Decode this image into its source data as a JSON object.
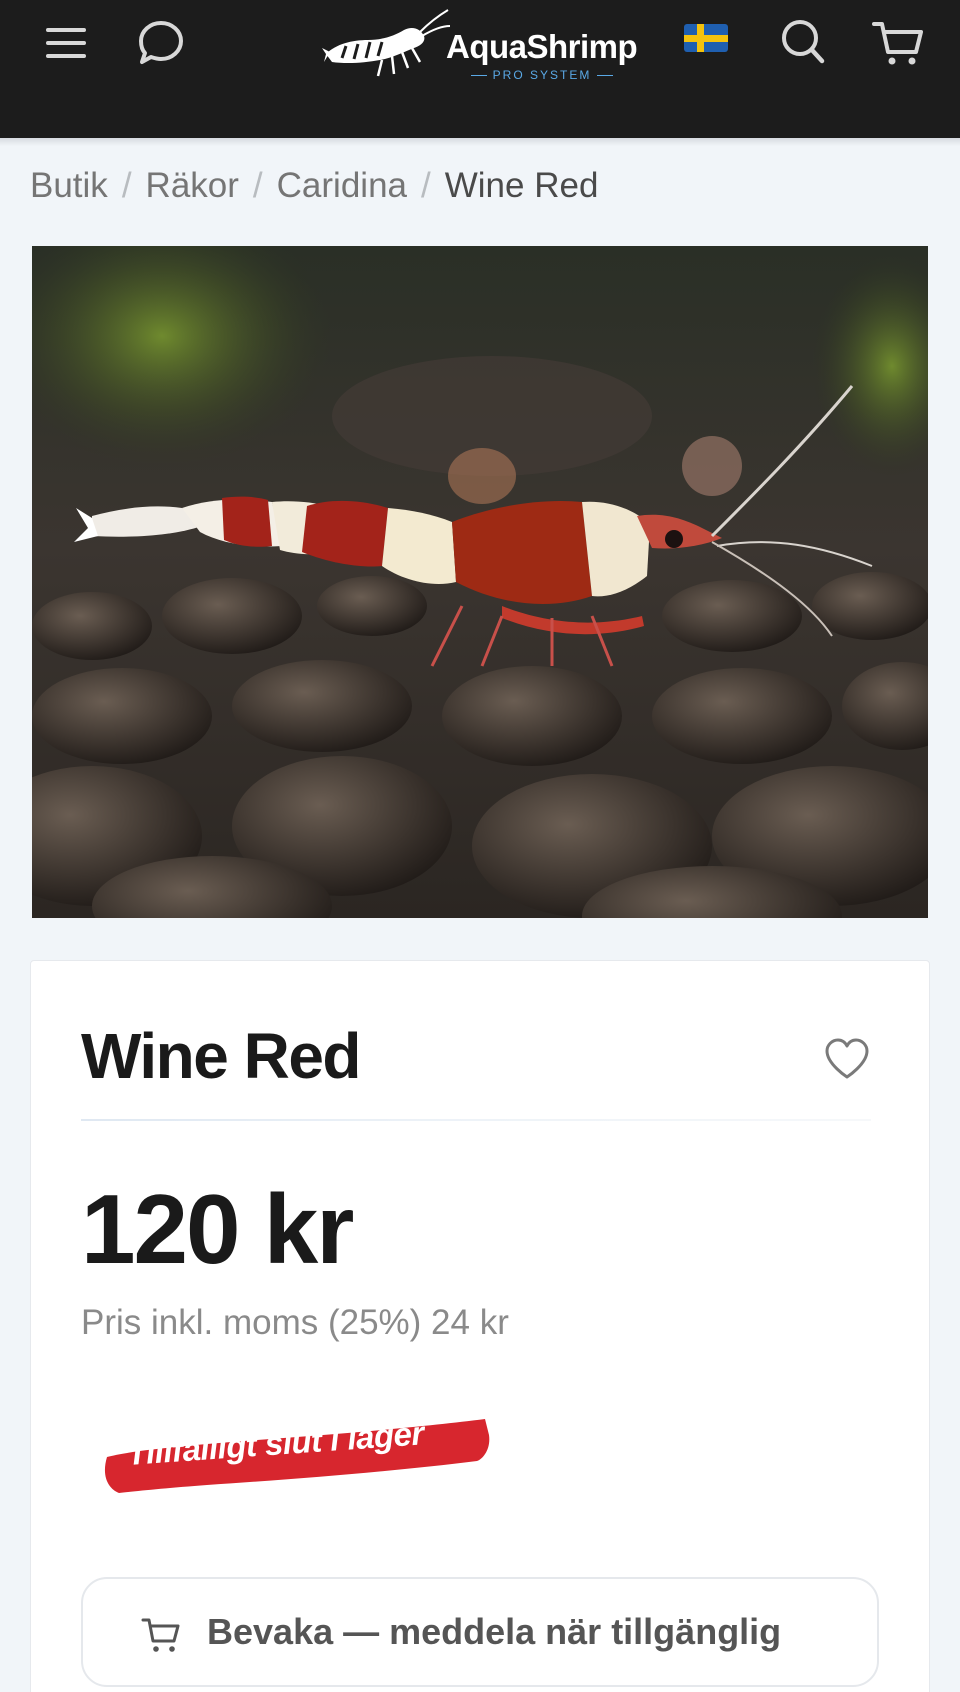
{
  "header": {
    "brand_name": "AquaShrimp",
    "brand_tagline": "PRO SYSTEM",
    "icons": [
      "menu-icon",
      "chat-icon",
      "sweden-flag-icon",
      "search-icon",
      "cart-icon"
    ]
  },
  "breadcrumb": {
    "items": [
      "Butik",
      "Räkor",
      "Caridina"
    ],
    "separator": "/",
    "current": "Wine Red"
  },
  "product": {
    "name": "Wine Red",
    "price": "120 kr",
    "vat_note": "Pris inkl. moms (25%) 24 kr",
    "stock_badge": "Tillfälligt slut i lager",
    "notify_button": "Bevaka — meddela när tillgänglig",
    "favorite_icon": "heart-icon"
  },
  "colors": {
    "header_bg": "#1c1c1c",
    "brand_accent": "#5aa9e6",
    "stock_badge": "#d7262e",
    "page_bg": "#f1f5f9"
  }
}
